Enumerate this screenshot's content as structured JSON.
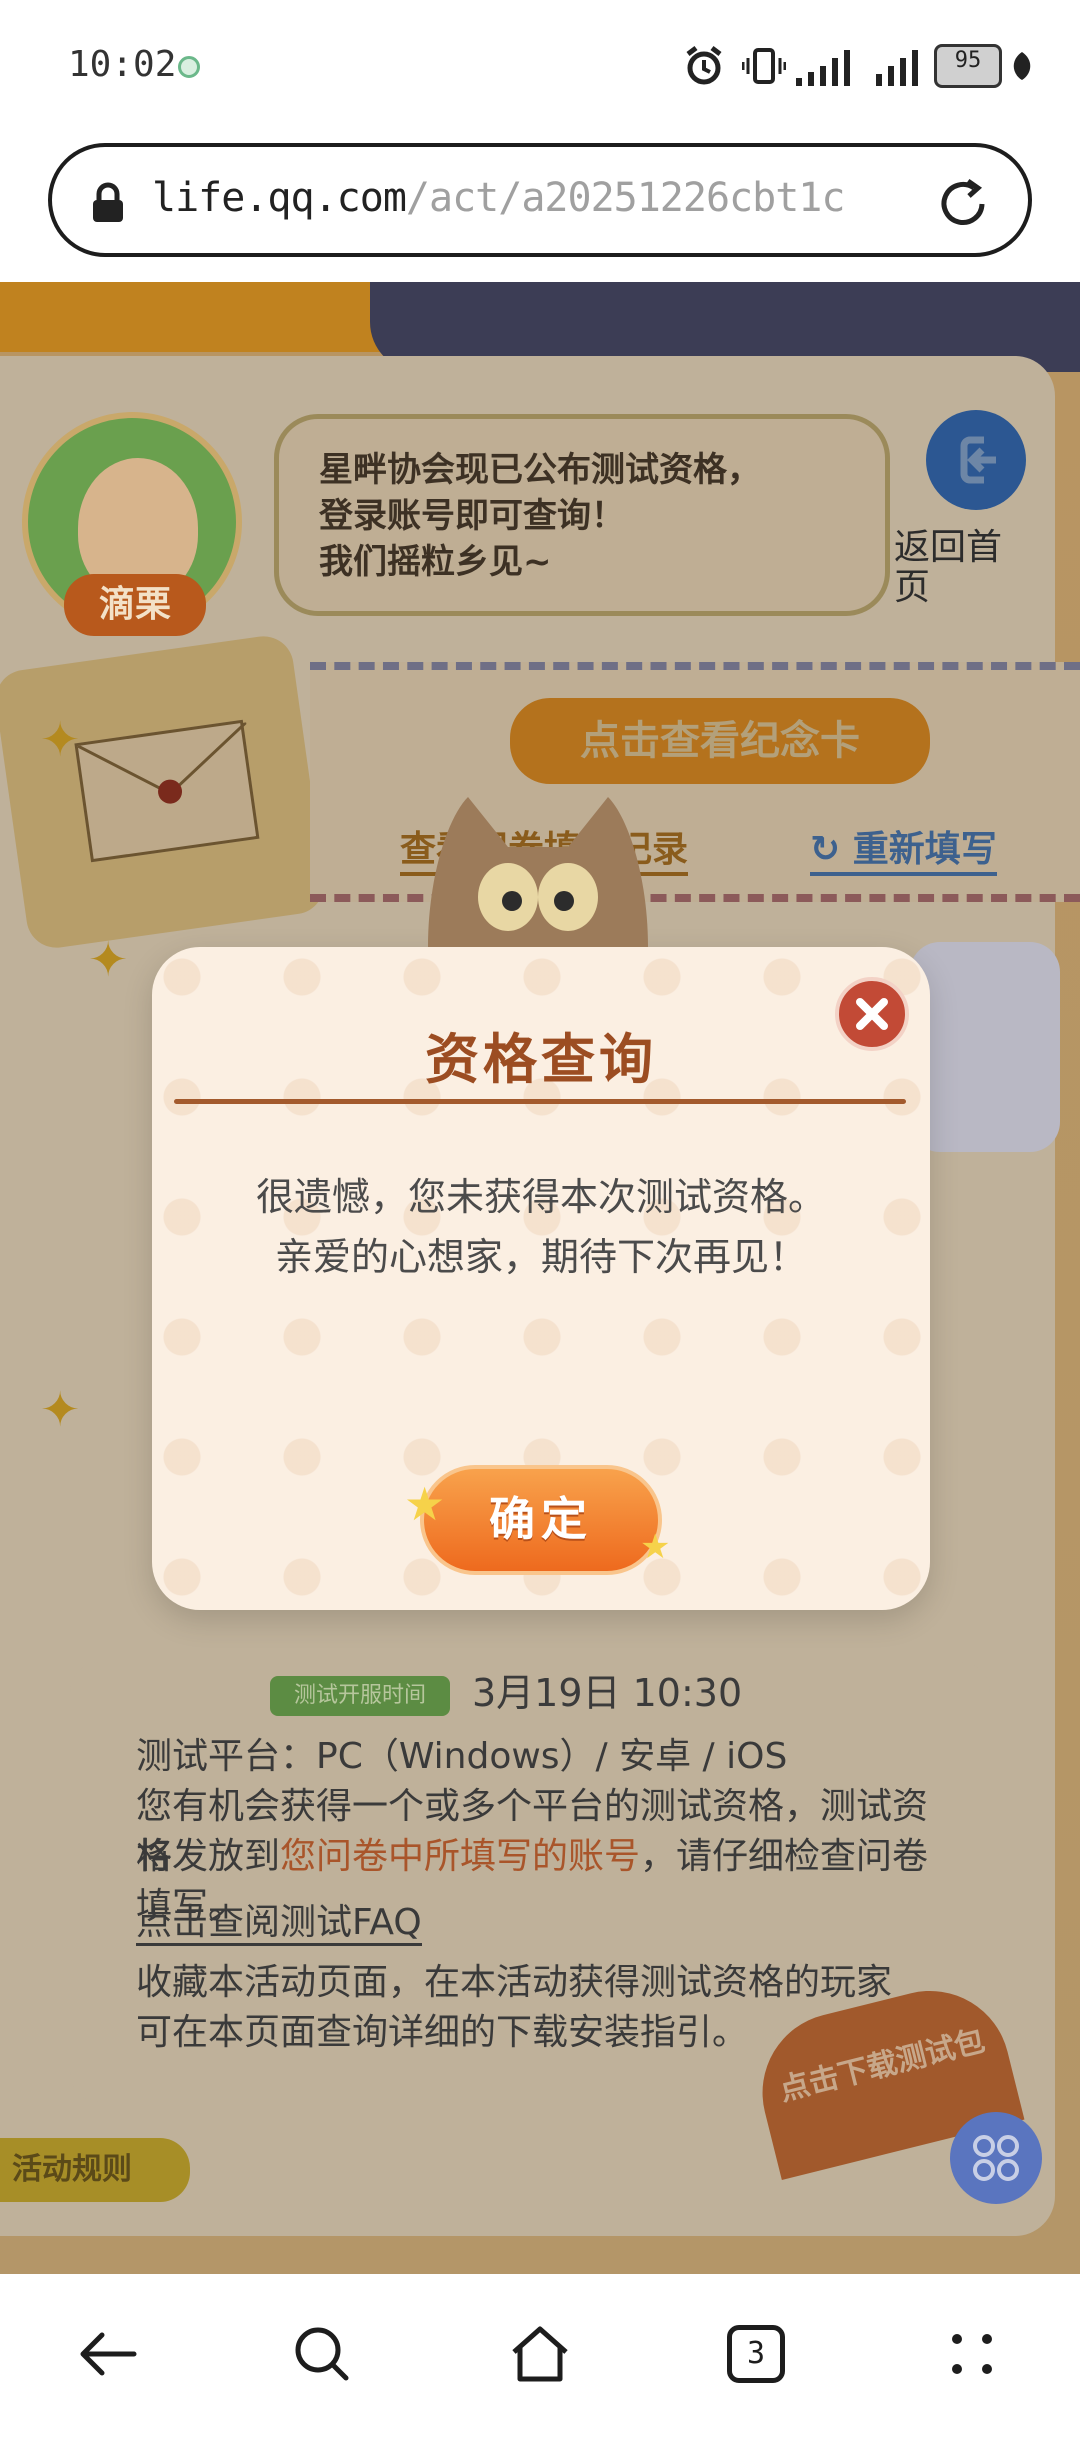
{
  "status_bar": {
    "time": "10:02",
    "battery": "95"
  },
  "address_bar": {
    "host": "life.qq.com",
    "path": "/act/a20251226cbt1c"
  },
  "page": {
    "avatar_name": "滴栗",
    "speech_lines": [
      "星畔协会现已公布测试资格，",
      "登录账号即可查询！",
      "我们摇粒乡见~"
    ],
    "back_home_label": "返回首页",
    "view_card_button": "点击查看纪念卡",
    "view_record_link": "查看问卷填写记录",
    "refill_link": "重新填写",
    "test_open_time_tag": "测试开服时间",
    "test_open_time_value": "3月19日  10:30",
    "info_lines": [
      {
        "plain": "测试平台：PC（Windows）/ 安卓 / iOS"
      },
      {
        "plain": "您有机会获得一个或多个平台的测试资格，测试资格"
      },
      {
        "before": "将发放到",
        "highlight": "您问卷中所填写的账号",
        "after": "，请仔细检查问卷填写。"
      },
      {
        "plain": "点击查阅测试FAQ",
        "link": true
      },
      {
        "plain": "收藏本活动页面，在本活动获得测试资格的玩家"
      },
      {
        "plain": "可在本页面查询详细的下载安装指引。"
      }
    ],
    "rules_tab": "活动规则",
    "download_tab": "点击下载测试包"
  },
  "modal": {
    "title": "资格查询",
    "message_line1": "很遗憾，您未获得本次测试资格。",
    "message_line2": "亲爱的心想家，期待下次再见！",
    "ok_button": "确定"
  },
  "bottom_nav": {
    "tab_count": "3"
  },
  "icons": {
    "status": [
      "alarm-icon",
      "vibrate-icon",
      "signal-icon",
      "signal-icon",
      "leaf-icon"
    ],
    "nav": [
      "back-arrow-icon",
      "search-icon",
      "home-icon",
      "tabs-icon",
      "menu-dots-icon"
    ]
  },
  "colors": {
    "modal_bg": "#fbefe2",
    "modal_title": "#9c4d22",
    "ok_button": "#ee6a1e",
    "close_button": "#c24a36"
  }
}
